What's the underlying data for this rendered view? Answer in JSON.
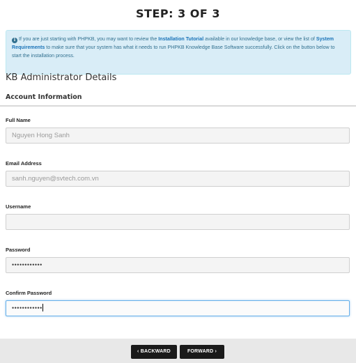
{
  "step_title": "STEP: 3 OF 3",
  "info": {
    "part1": "If you are just starting with PHPKB, you may want to review the ",
    "link1": "Installation Tutorial",
    "part2": " available in our knowledge base, or view the list of ",
    "link2": "System Requirements",
    "part3": " to make sure that your system has what it needs to run PHPKB Knowledge Base Software successfully. Click on the button below to start the installation process."
  },
  "section_heading": "KB Administrator Details",
  "sub_heading": "Account Information",
  "fields": {
    "full_name": {
      "label": "Full Name",
      "placeholder": "Nguyen Hong Sanh"
    },
    "email": {
      "label": "Email Address",
      "placeholder": "sanh.nguyen@svtech.com.vn"
    },
    "username": {
      "label": "Username",
      "value": ""
    },
    "password": {
      "label": "Password",
      "value": "••••••••••••"
    },
    "confirm_password": {
      "label": "Confirm Password",
      "value": "••••••••••••"
    }
  },
  "buttons": {
    "backward": "‹ BACKWARD",
    "forward": "FORWARD ›"
  },
  "colors": {
    "info_bg": "#d9edf7",
    "link": "#1a73b8",
    "button_bg": "#1a1a1a",
    "focus_border": "#66afe9"
  }
}
